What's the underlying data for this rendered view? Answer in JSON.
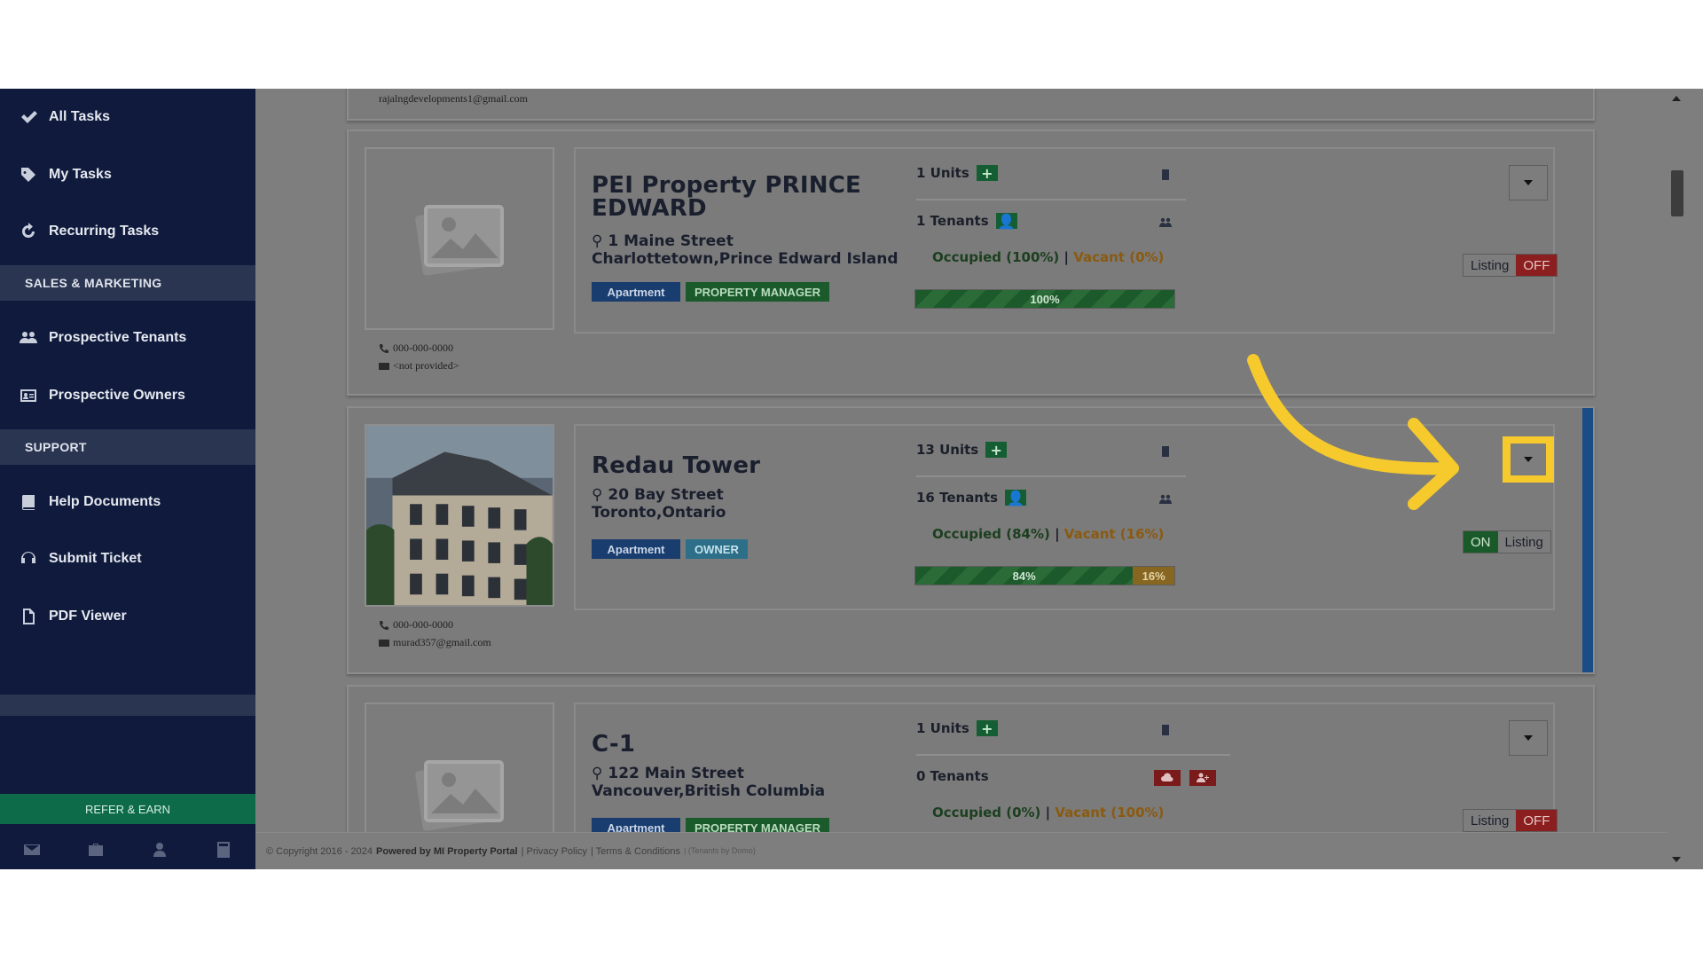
{
  "sidebar": {
    "items": [
      {
        "label": "All Tasks",
        "icon": "check-icon"
      },
      {
        "label": "My Tasks",
        "icon": "tag-icon"
      },
      {
        "label": "Recurring Tasks",
        "icon": "refresh-icon"
      }
    ],
    "section_sales": "SALES & MARKETING",
    "sales_items": [
      {
        "label": "Prospective Tenants",
        "icon": "users-icon"
      },
      {
        "label": "Prospective Owners",
        "icon": "id-card-icon"
      }
    ],
    "section_support": "SUPPORT",
    "support_items": [
      {
        "label": "Help Documents",
        "icon": "book-icon"
      },
      {
        "label": "Submit Ticket",
        "icon": "headset-icon"
      },
      {
        "label": "PDF Viewer",
        "icon": "pdf-icon"
      }
    ],
    "refer_label": "REFER & EARN",
    "footer_icons": [
      "envelope-icon",
      "briefcase-icon",
      "user-icon",
      "calculator-icon"
    ]
  },
  "top_partial_email": "rajalngdevelopments1@gmail.com",
  "properties": [
    {
      "name": "PEI Property PRINCE EDWARD",
      "address_line1": "1 Maine Street",
      "address_line2": "Charlottetown,Prince Edward Island",
      "type_tag": "Apartment",
      "role_tag": "PROPERTY MANAGER",
      "units": "1 Units",
      "tenants": "1 Tenants",
      "occupied": "Occupied (100%)",
      "vacant": "Vacant (0%)",
      "occupied_bar_label": "100%",
      "occupied_pct": 100,
      "listing_label": "Listing",
      "listing_state": "OFF",
      "phone": "000-000-0000",
      "email": "<not provided>"
    },
    {
      "name": "Redau Tower",
      "address_line1": "20 Bay Street",
      "address_line2": "Toronto,Ontario",
      "type_tag": "Apartment",
      "role_tag": "OWNER",
      "units": "13 Units",
      "tenants": "16 Tenants",
      "occupied": "Occupied (84%)",
      "vacant": "Vacant (16%)",
      "occupied_bar_label": "84%",
      "vacant_bar_label": "16%",
      "occupied_pct": 84,
      "listing_label": "Listing",
      "listing_state": "ON",
      "phone": "000-000-0000",
      "email": "murad357@gmail.com"
    },
    {
      "name": "C-1",
      "address_line1": "122 Main Street",
      "address_line2": "Vancouver,British Columbia",
      "type_tag": "Apartment",
      "role_tag": "PROPERTY MANAGER",
      "units": "1 Units",
      "tenants": "0 Tenants",
      "occupied": "Occupied (0%)",
      "vacant": "Vacant (100%)",
      "listing_label": "Listing",
      "listing_state": "OFF"
    }
  ],
  "separator": "|",
  "footer": {
    "copyright": "© Copyright 2016 - 2024",
    "powered": "Powered by MI Property Portal",
    "privacy": "| Privacy Policy",
    "terms": "| Terms & Conditions",
    "tiny": "| (Tenants by Domo)"
  },
  "colors": {
    "sidebar_bg": "#0f1a3c",
    "highlight": "#f6c92c",
    "annotation_arrow": "#f6c92c"
  }
}
